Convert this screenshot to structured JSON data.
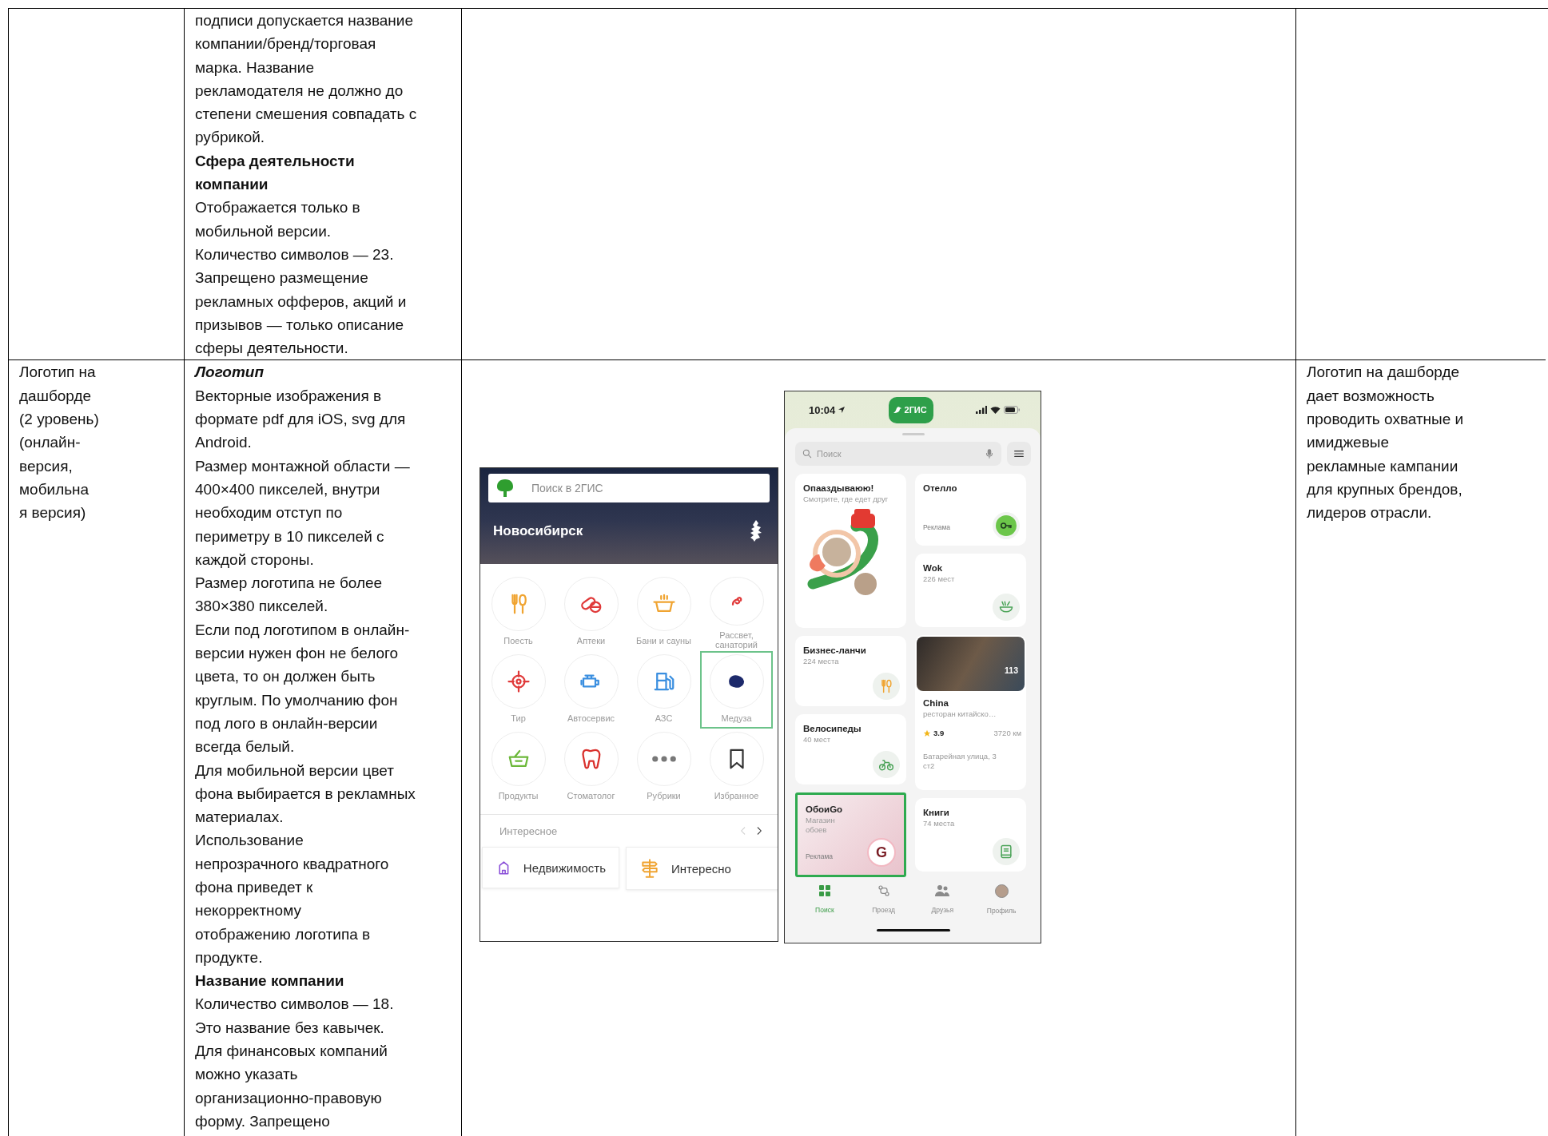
{
  "table": {
    "rows": [
      {
        "column_2": [
          {
            "kind": "text",
            "text": "подписи допускается название\nкомпании/бренд/торговая\nмарка.  Название\nрекламодателя не должно до\nстепени смешения совпадать с\nрубрикой."
          },
          {
            "kind": "heading",
            "italic": false,
            "text": "Сфера деятельности\nкомпании"
          },
          {
            "kind": "text",
            "text": "Отображается только в\nмобильной версии."
          },
          {
            "kind": "text",
            "text": "Количество символов — 23."
          },
          {
            "kind": "text",
            "text": "Запрещено размещение\nрекламных офферов, акций и\nпризывов — только описание\nсферы деятельности."
          }
        ]
      },
      {
        "column_1": [
          {
            "kind": "text",
            "text": "Логотип на\nдашборде\n(2 уровень)\n(онлайн-\nверсия,\nмобильна\nя версия)"
          }
        ],
        "column_2": [
          {
            "kind": "heading",
            "italic": true,
            "text": "Логотип"
          },
          {
            "kind": "text",
            "text": "Векторные изображения в\nформате pdf для iOS, svg для\nAndroid."
          },
          {
            "kind": "text",
            "text": "Размер монтажной области —\n400×400 пикселей, внутри\nнеобходим отступ по\nпериметру в 10 пикселей с\nкаждой стороны."
          },
          {
            "kind": "text",
            "text": "Размер логотипа не более\n380×380 пикселей."
          },
          {
            "kind": "text",
            "text": "Если под логотипом в онлайн-\nверсии нужен фон не белого\nцвета, то он должен быть\nкруглым. По умолчанию фон\nпод лого в онлайн-версии\nвсегда белый."
          },
          {
            "kind": "text",
            "text": "Для мобильной версии цвет\nфона выбирается в рекламных\nматериалах."
          },
          {
            "kind": "text",
            "text": "Использование\nнепрозрачного квадратного\nфона приведет к\nнекорректному\nотображению логотипа в\nпродукте."
          },
          {
            "kind": "heading",
            "italic": false,
            "text": "Название компании"
          },
          {
            "kind": "text",
            "text": "Количество символов — 18."
          },
          {
            "kind": "text",
            "text": "Это название без кавычек."
          },
          {
            "kind": "text",
            "text": "Для финансовых компаний\nможно указать\nорганизационно-правовую\nформу. Запрещено"
          }
        ],
        "column_3": {
          "web_app": {
            "search": {
              "placeholder": "Поиск в 2ГИС"
            },
            "city": "Новосибирск",
            "categories": [
              {
                "kind": "cutlery",
                "label": "Поесть",
                "highlighted": false
              },
              {
                "kind": "pills",
                "label": "Аптеки",
                "highlighted": false
              },
              {
                "kind": "pot",
                "label": "Бани и сауны",
                "highlighted": false
              },
              {
                "kind": "sprig",
                "label": "Рассвет, санаторий",
                "highlighted": false
              },
              {
                "kind": "target",
                "label": "Тир",
                "highlighted": false
              },
              {
                "kind": "engine",
                "label": "Автосервис",
                "highlighted": false
              },
              {
                "kind": "fuel",
                "label": "АЗС",
                "highlighted": false
              },
              {
                "kind": "splash",
                "label": "Медуза",
                "highlighted": true
              },
              {
                "kind": "basket",
                "label": "Продукты",
                "highlighted": false
              },
              {
                "kind": "tooth",
                "label": "Стоматолог",
                "highlighted": false
              },
              {
                "kind": "dots",
                "label": "Рубрики",
                "highlighted": false
              },
              {
                "kind": "bookmark",
                "label": "Избранное",
                "highlighted": false
              }
            ],
            "section_title": "Интересное",
            "cards": [
              {
                "kind": "building",
                "label": "Недвижимость"
              },
              {
                "kind": "signpost",
                "label": "Интересно"
              }
            ]
          },
          "mobile_app": {
            "status_bar": {
              "time": "10:04",
              "app_badge": "2ГИС"
            },
            "search": {
              "placeholder": "Поиск"
            },
            "left_cards": [
              {
                "kind": "illustration",
                "title": "Опааздываюю!",
                "subtitle": "Смотрите, где едет друг",
                "highlighted": false
              },
              {
                "kind": "cutlery",
                "title": "Бизнес-ланчи",
                "subtitle": "224 места",
                "highlighted": false
              },
              {
                "kind": "bike",
                "title": "Велосипеды",
                "subtitle": "40 мест",
                "highlighted": false
              },
              {
                "kind": "brand-ad",
                "title": "ОбоиGo",
                "subtitle": "Магазин\nобоев",
                "ad_label": "Реклама",
                "logo_letter": "G",
                "highlighted": true
              }
            ],
            "right_cards": [
              {
                "kind": "key",
                "title": "Отелло",
                "ad_label": "Реклама",
                "highlighted": false
              },
              {
                "kind": "bowl",
                "title": "Wok",
                "subtitle": "226 мест",
                "highlighted": false
              },
              {
                "kind": "place",
                "photo_count": "113",
                "title": "China",
                "subtitle": "ресторан китайско…",
                "rating": "3.9",
                "distance": "3720 км",
                "address": "Батарейная улица, 3\nст2",
                "highlighted": false
              },
              {
                "kind": "book",
                "title": "Книги",
                "subtitle": "74 места",
                "highlighted": false
              }
            ],
            "tabs": [
              {
                "label": "Поиск",
                "selected": true
              },
              {
                "label": "Проезд",
                "selected": false
              },
              {
                "label": "Друзья",
                "selected": false
              },
              {
                "label": "Профиль",
                "selected": false
              }
            ]
          }
        },
        "column_4": [
          {
            "kind": "text",
            "text": "Логотип на дашборде\nдает возможность\nпроводить охватные и\nимиджевые\nрекламные кампании\nдля крупных брендов,\nлидеров отрасли."
          }
        ]
      }
    ]
  }
}
